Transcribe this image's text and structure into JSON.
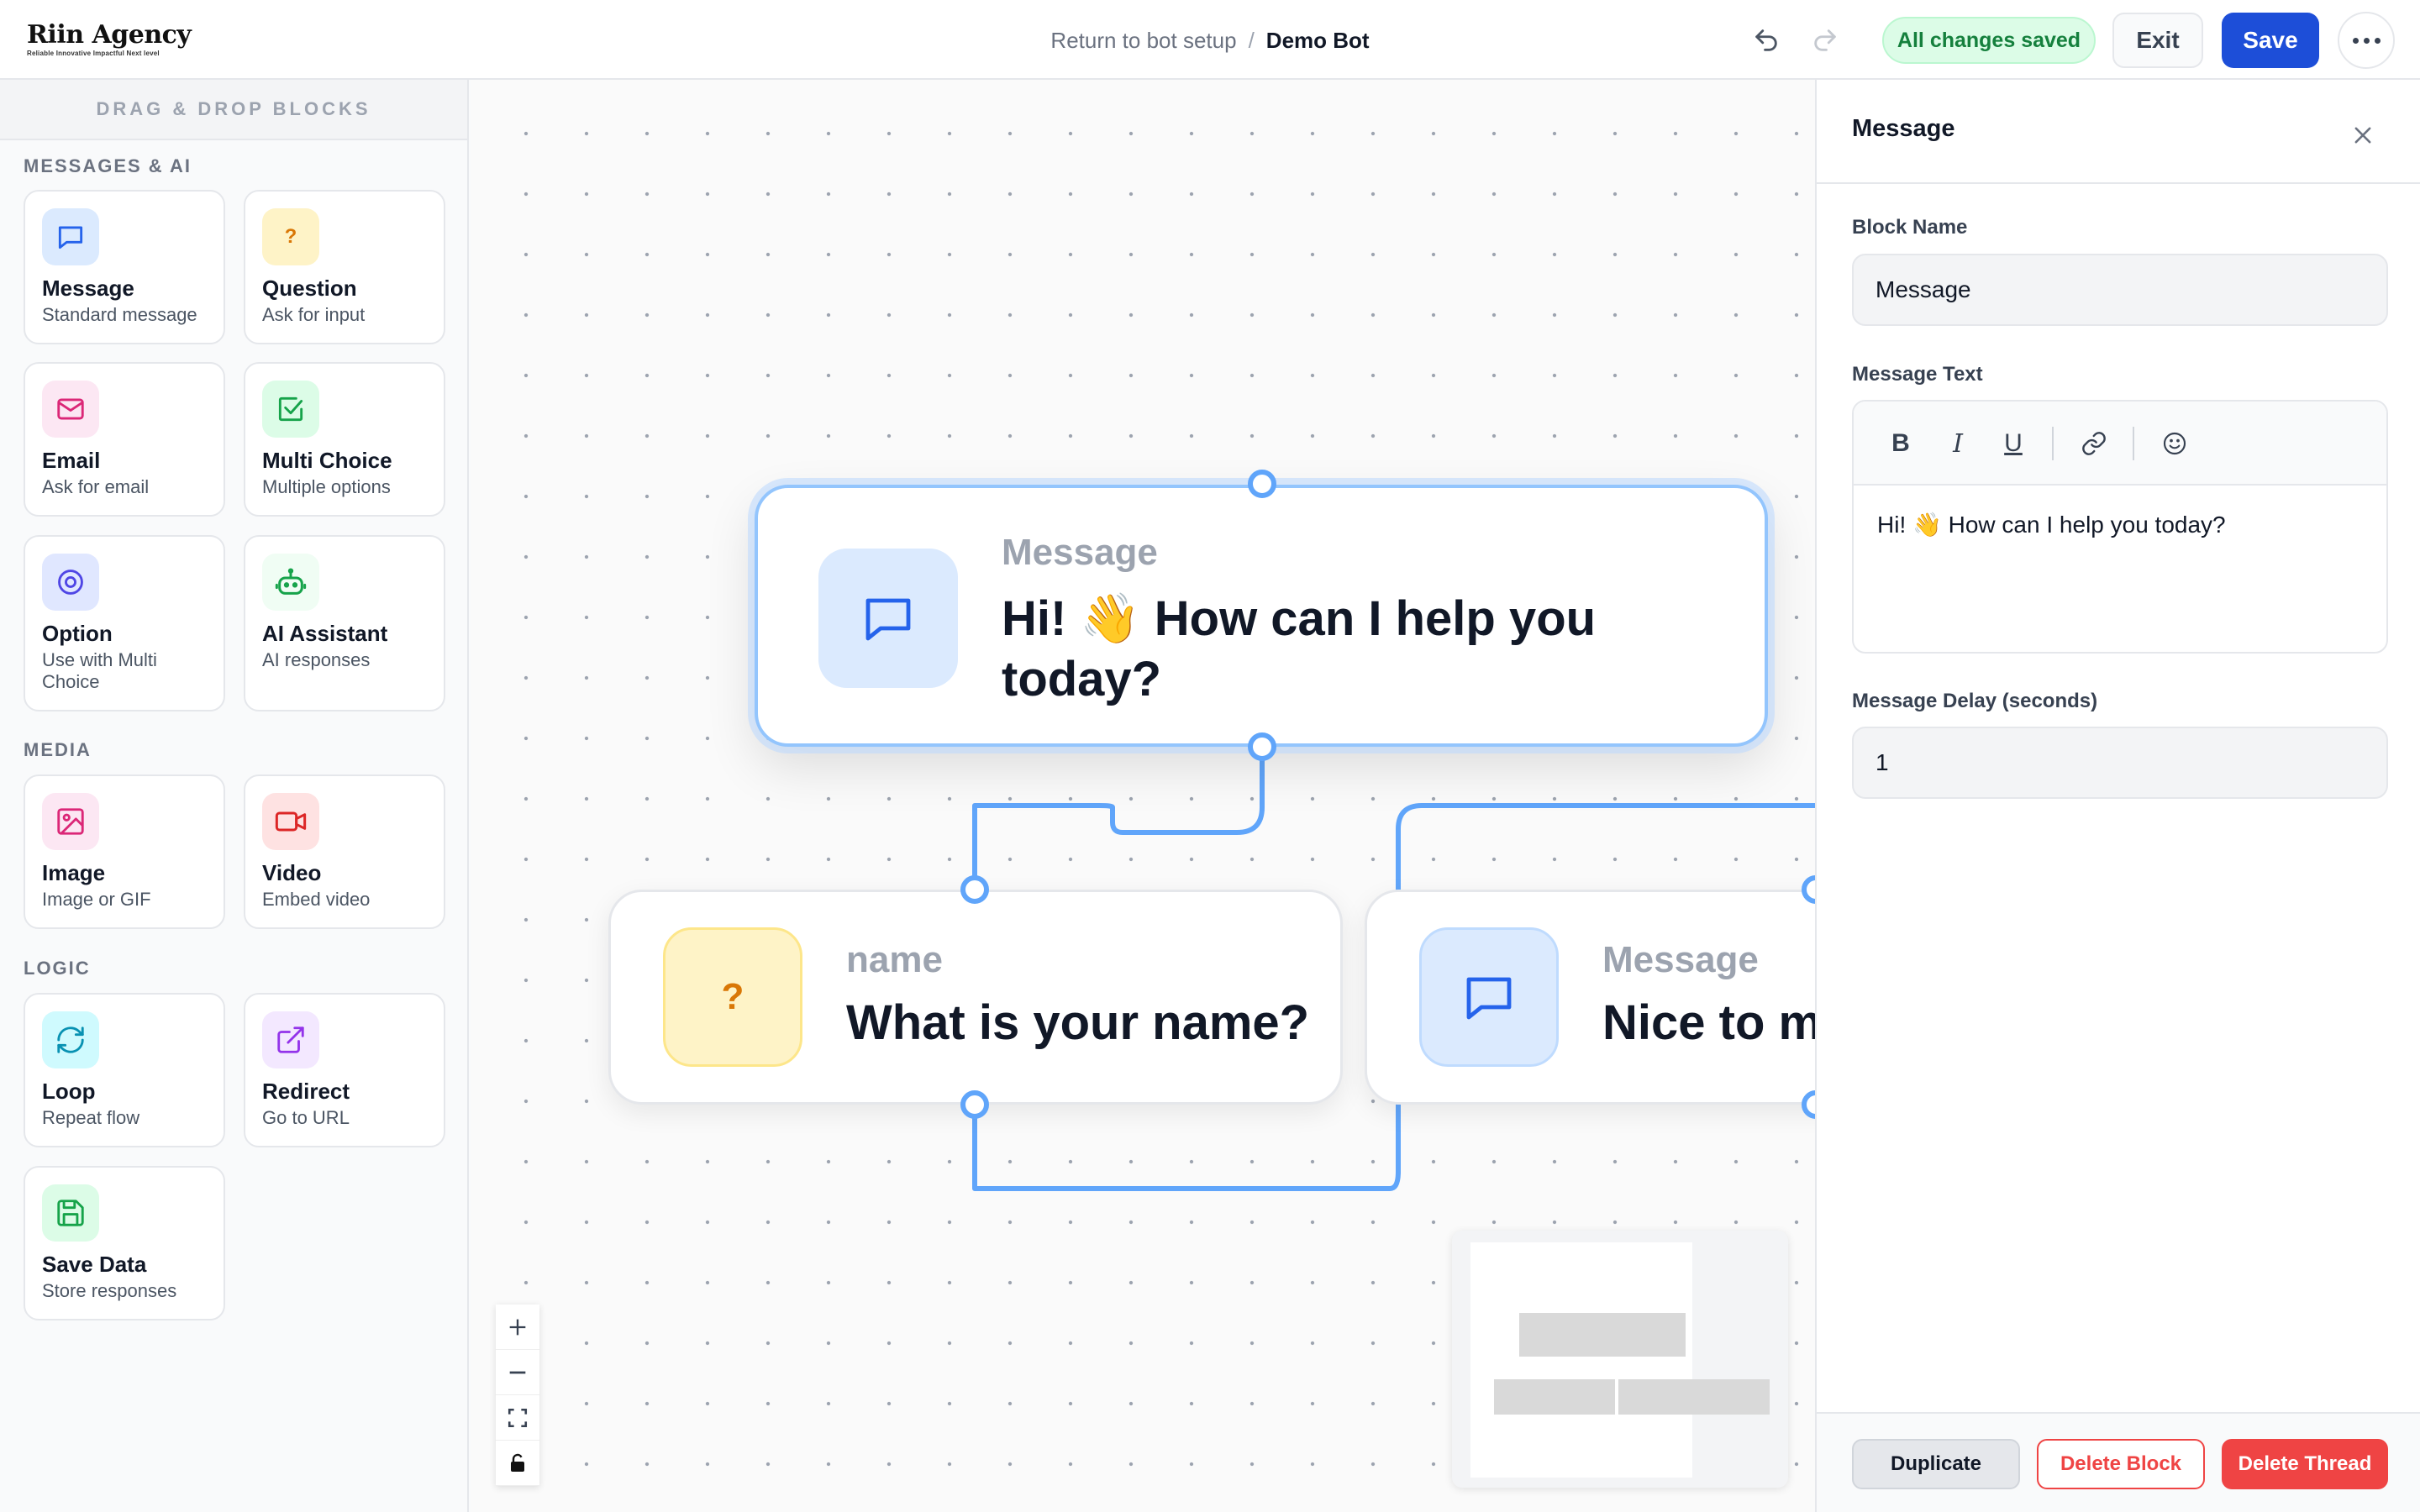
{
  "header": {
    "logo_title": "Riin Agency",
    "logo_tagline": "Reliable Innovative Impactful Next level",
    "breadcrumb_link": "Return to bot setup",
    "breadcrumb_separator": "/",
    "breadcrumb_current": "Demo Bot",
    "status": "All changes saved",
    "exit_label": "Exit",
    "save_label": "Save"
  },
  "sidebar": {
    "title": "DRAG & DROP BLOCKS",
    "sections": {
      "messages": {
        "label": "MESSAGES & AI",
        "items": [
          {
            "title": "Message",
            "subtitle": "Standard message",
            "icon": "chat-bubble-icon"
          },
          {
            "title": "Question",
            "subtitle": "Ask for input",
            "icon": "question-icon"
          },
          {
            "title": "Email",
            "subtitle": "Ask for email",
            "icon": "envelope-icon"
          },
          {
            "title": "Multi Choice",
            "subtitle": "Multiple options",
            "icon": "checkbox-icon"
          },
          {
            "title": "Option",
            "subtitle": "Use with Multi Choice",
            "icon": "radio-icon"
          },
          {
            "title": "AI Assistant",
            "subtitle": "AI responses",
            "icon": "robot-icon"
          }
        ]
      },
      "media": {
        "label": "MEDIA",
        "items": [
          {
            "title": "Image",
            "subtitle": "Image or GIF",
            "icon": "image-icon"
          },
          {
            "title": "Video",
            "subtitle": "Embed video",
            "icon": "video-icon"
          }
        ]
      },
      "logic": {
        "label": "LOGIC",
        "items": [
          {
            "title": "Loop",
            "subtitle": "Repeat flow",
            "icon": "loop-icon"
          },
          {
            "title": "Redirect",
            "subtitle": "Go to URL",
            "icon": "external-link-icon"
          },
          {
            "title": "Save Data",
            "subtitle": "Store responses",
            "icon": "floppy-disk-icon"
          }
        ]
      }
    }
  },
  "canvas": {
    "nodes": [
      {
        "label": "Message",
        "text": "Hi! 👋  How can I help you today?",
        "icon": "chat-bubble-icon",
        "selected": true
      },
      {
        "label": "name",
        "text": "What is your name?",
        "icon": "question-icon"
      },
      {
        "label": "Message",
        "text": "Nice to m",
        "icon": "chat-bubble-icon"
      }
    ],
    "question_mark": "?",
    "zoom_controls": [
      "zoom-in",
      "zoom-out",
      "fit-view",
      "lock"
    ]
  },
  "panel": {
    "title": "Message",
    "block_name_label": "Block Name",
    "block_name_value": "Message",
    "message_text_label": "Message Text",
    "message_text_value": "Hi! 👋  How can I help you today?",
    "toolbar": {
      "bold": "B",
      "italic": "I",
      "underline": "U"
    },
    "delay_label": "Message Delay (seconds)",
    "delay_value": "1",
    "duplicate_label": "Duplicate",
    "delete_block_label": "Delete Block",
    "delete_thread_label": "Delete Thread"
  },
  "colors": {
    "primary": "#1d4ed8",
    "success_bg": "#dcfce7",
    "success_text": "#15803d",
    "danger": "#ef4444",
    "connector": "#60a5fa"
  }
}
